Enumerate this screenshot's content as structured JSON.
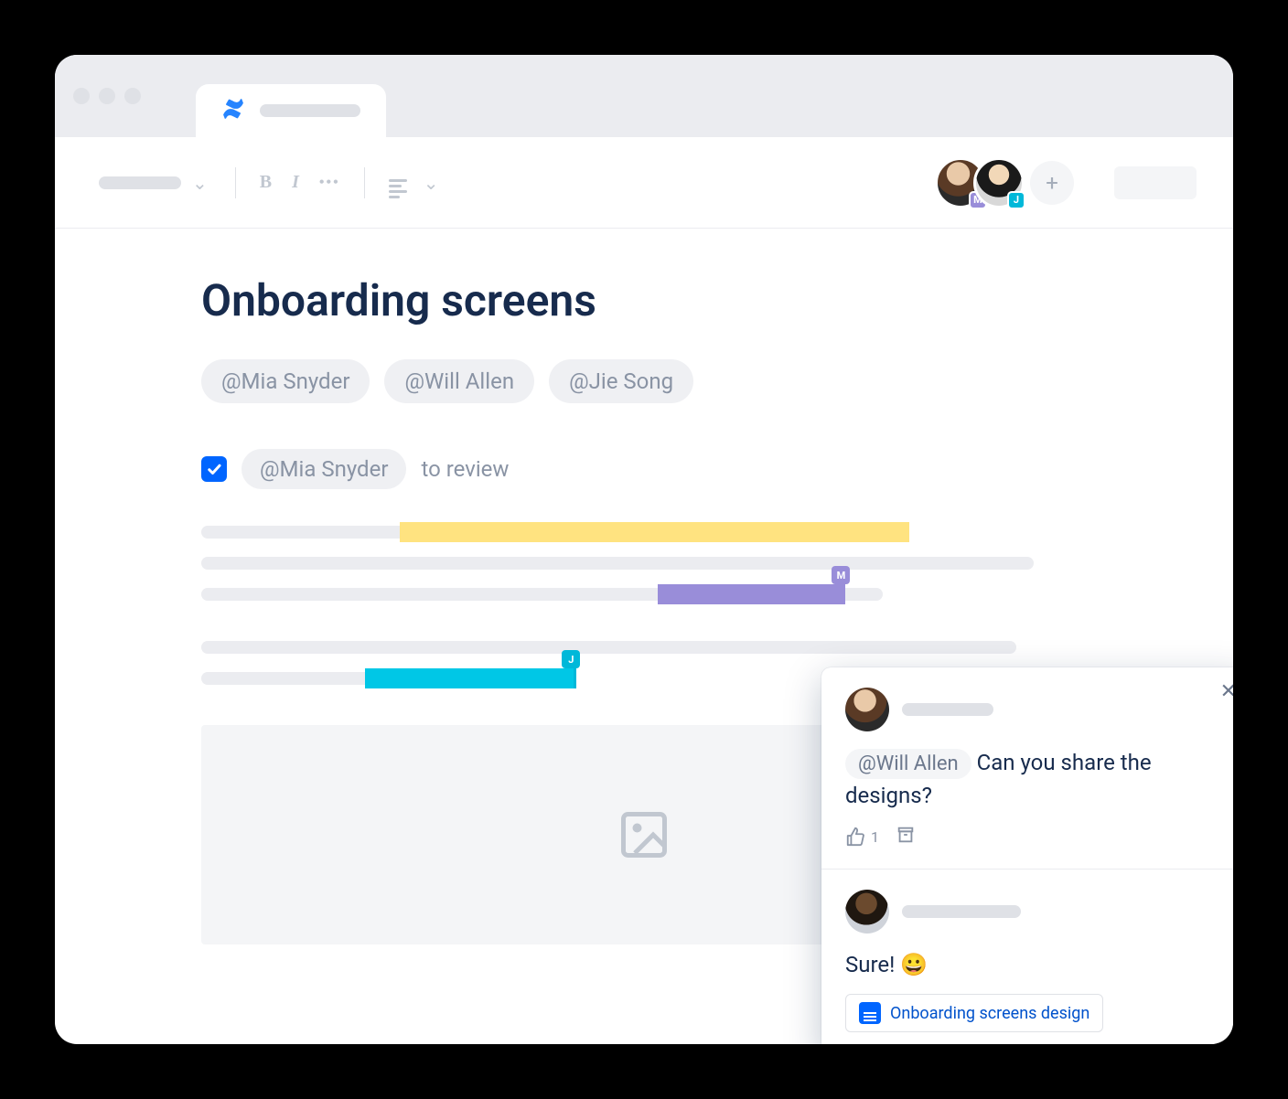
{
  "document": {
    "title": "Onboarding screens",
    "mentions": [
      "@Mia Snyder",
      "@Will Allen",
      "@Jie Song"
    ],
    "task": {
      "checked": true,
      "assignee": "@Mia Snyder",
      "text": "to review"
    }
  },
  "collaborators": [
    {
      "initial": "M",
      "badge_color": "#998DD9"
    },
    {
      "initial": "J",
      "badge_color": "#00B8D9"
    }
  ],
  "cursors": {
    "m_label": "M",
    "j_label": "J"
  },
  "comments": [
    {
      "mention": "@Will Allen",
      "message": "Can you share the designs?",
      "like_count": "1"
    },
    {
      "message": "Sure! 😀",
      "attachment": "Onboarding screens design"
    }
  ]
}
